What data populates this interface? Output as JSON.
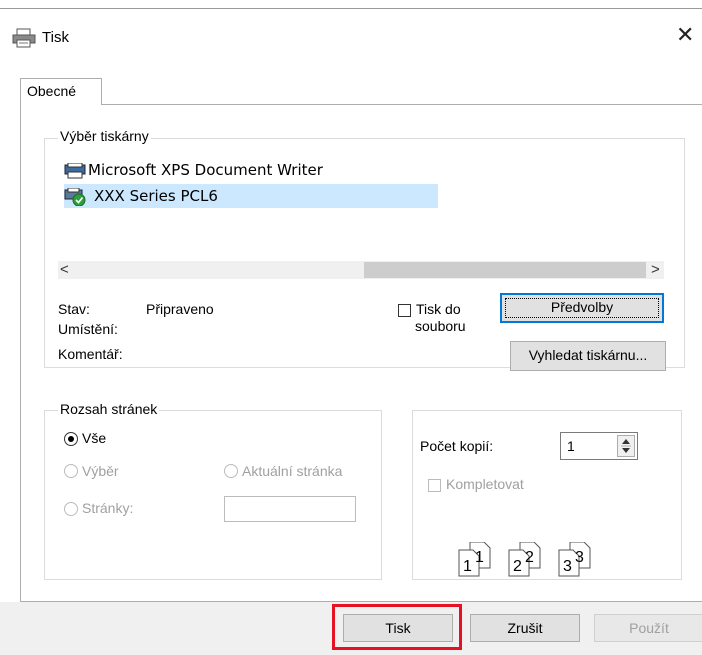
{
  "window": {
    "title": "Tisk",
    "close_glyph": "✕"
  },
  "tabs": [
    {
      "label": "Obecné"
    }
  ],
  "printer_section": {
    "legend": "Výběr tiskárny",
    "printers": [
      {
        "name": "Microsoft XPS Document Writer"
      },
      {
        "name": "XXX Series PCL6",
        "selected": true
      }
    ],
    "scroll_left": "<",
    "scroll_right": ">",
    "status_label": "Stav:",
    "status_value": "Připraveno",
    "location_label": "Umístění:",
    "comment_label": "Komentář:",
    "print_to_file_label_1": "Tisk do",
    "print_to_file_label_2": "souboru",
    "preferences_button": "Předvolby",
    "find_printer_button": "Vyhledat tiskárnu..."
  },
  "page_range": {
    "legend": "Rozsah stránek",
    "all": "Vše",
    "selection": "Výběr",
    "current_page": "Aktuální stránka",
    "pages": "Stránky:",
    "pages_value": ""
  },
  "copies": {
    "label": "Počet kopií:",
    "value": "1",
    "collate": "Kompletovat",
    "collate_numbers": [
      "1",
      "2",
      "3"
    ]
  },
  "buttons": {
    "print": "Tisk",
    "cancel": "Zrušit",
    "apply": "Použít"
  },
  "colors": {
    "selection": "#cce8ff",
    "scroll_thumb": "#cdcdcd",
    "highlight_box": "#e81123",
    "default_button_border": "#0078d7"
  }
}
